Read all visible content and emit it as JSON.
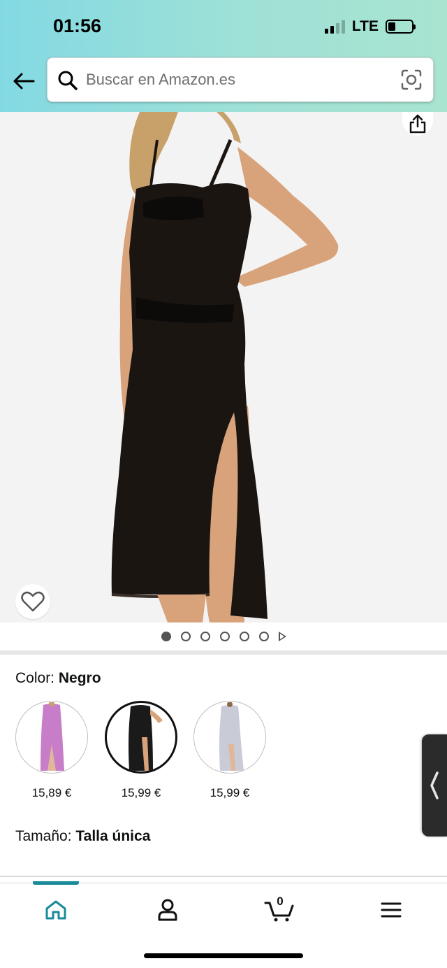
{
  "status_bar": {
    "time": "01:56",
    "network": "LTE",
    "signal_bars_active": 2,
    "signal_bars_total": 4,
    "battery_level": 0.3
  },
  "search": {
    "placeholder": "Buscar en Amazon.es",
    "value": ""
  },
  "icons": {
    "back": "back-arrow-icon",
    "search": "search-icon",
    "camera": "camera-scan-icon",
    "share": "share-icon",
    "wishlist": "heart-icon",
    "home": "home-icon",
    "account": "user-icon",
    "cart": "cart-icon",
    "menu": "hamburger-menu-icon",
    "side_tab": "chevron-left-icon"
  },
  "product": {
    "image_count": 6,
    "active_image_index": 0,
    "has_video": true
  },
  "color": {
    "label": "Color: ",
    "selected": "Negro",
    "options": [
      {
        "name": "pink",
        "price": "15,89 €",
        "tint": "#c77dc8"
      },
      {
        "name": "black",
        "price": "15,99 €",
        "tint": "#1a1a1a"
      },
      {
        "name": "silver",
        "price": "15,99 €",
        "tint": "#c9cbd6"
      }
    ]
  },
  "size": {
    "label": "Tamaño: ",
    "selected": "Talla única"
  },
  "bottom_nav": {
    "cart_count": "0",
    "active": "home"
  },
  "colors": {
    "header_gradient_start": "#83d9e3",
    "header_gradient_end": "#a8e4d0",
    "accent": "#1a8a9a"
  }
}
